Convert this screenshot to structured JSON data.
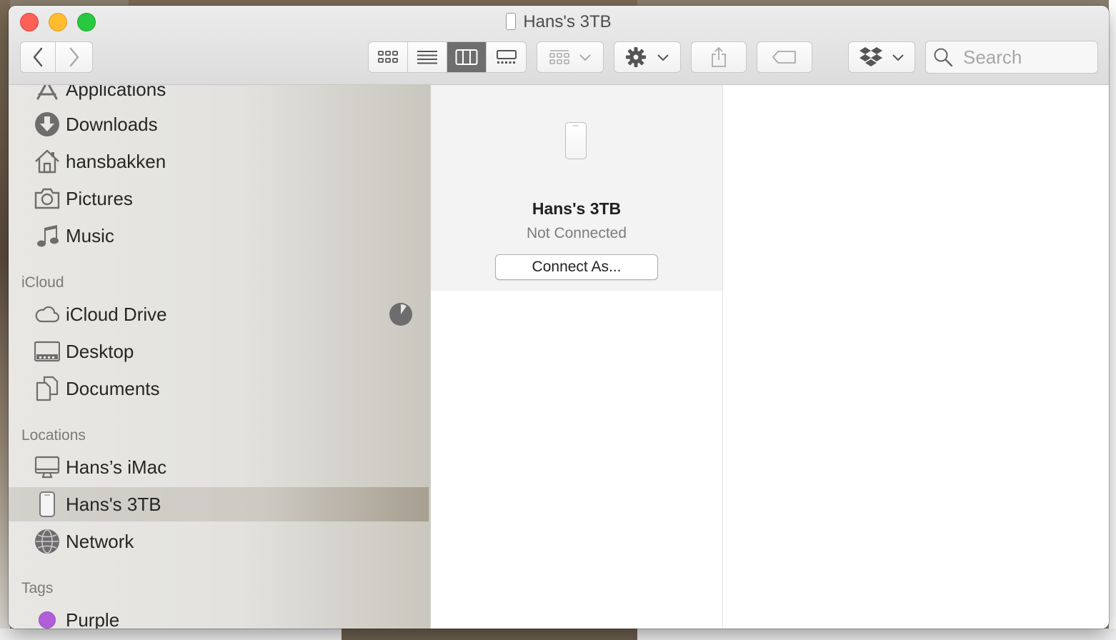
{
  "window": {
    "title": "Hans's 3TB"
  },
  "toolbar": {
    "search_placeholder": "Search"
  },
  "sidebar": {
    "partial_top_item": "Applications",
    "favorites": [
      {
        "label": "Downloads",
        "icon": "downloads-icon"
      },
      {
        "label": "hansbakken",
        "icon": "home-icon"
      },
      {
        "label": "Pictures",
        "icon": "camera-icon"
      },
      {
        "label": "Music",
        "icon": "music-note-icon"
      }
    ],
    "icloud_header": "iCloud",
    "icloud": [
      {
        "label": "iCloud Drive",
        "icon": "cloud-icon"
      },
      {
        "label": "Desktop",
        "icon": "desktop-folder-icon"
      },
      {
        "label": "Documents",
        "icon": "documents-icon"
      }
    ],
    "locations_header": "Locations",
    "locations": [
      {
        "label": "Hans’s iMac",
        "icon": "imac-icon"
      },
      {
        "label": "Hans's 3TB",
        "icon": "airport-disk-icon",
        "selected": true
      },
      {
        "label": "Network",
        "icon": "network-globe-icon"
      }
    ],
    "tags_header": "Tags",
    "tags": [
      {
        "label": "Purple",
        "color": "#b05fd9"
      }
    ]
  },
  "preview": {
    "name": "Hans's 3TB",
    "status": "Not Connected",
    "connect_label": "Connect As..."
  },
  "colors": {
    "selected_view": "#6e6e6e",
    "close": "#fe5f57",
    "minimize": "#febc2e",
    "maximize": "#28c840"
  }
}
